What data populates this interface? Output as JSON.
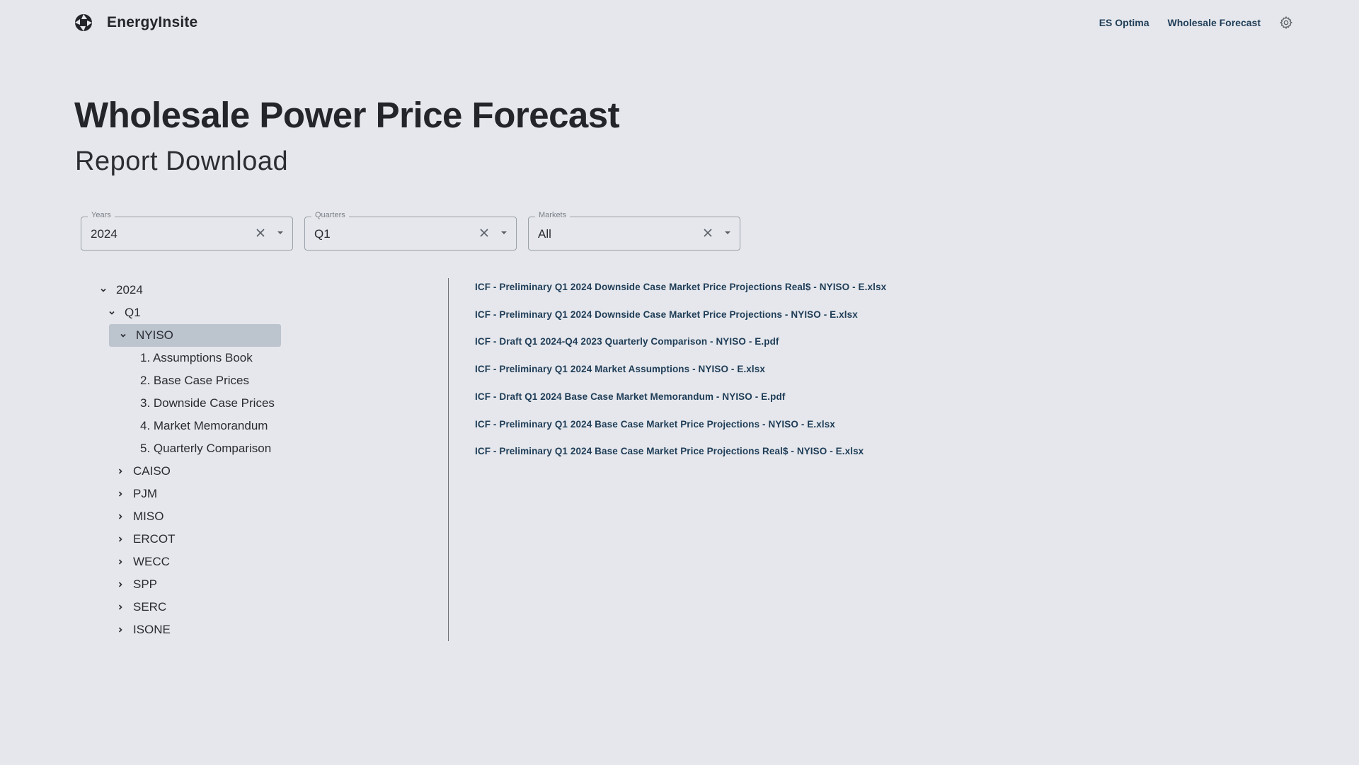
{
  "header": {
    "brand": "EnergyInsite",
    "nav": [
      "ES Optima",
      "Wholesale Forecast"
    ],
    "settings_icon": "gear-icon"
  },
  "page": {
    "title": "Wholesale Power Price Forecast",
    "subtitle": "Report Download"
  },
  "filters": {
    "years": {
      "label": "Years",
      "value": "2024"
    },
    "quarters": {
      "label": "Quarters",
      "value": "Q1"
    },
    "markets": {
      "label": "Markets",
      "value": "All"
    }
  },
  "tree": {
    "year": "2024",
    "quarter": "Q1",
    "selected_market": "NYISO",
    "reports": [
      "1. Assumptions Book",
      "2. Base Case Prices",
      "3. Downside Case Prices",
      "4. Market Memorandum",
      "5. Quarterly Comparison"
    ],
    "other_markets": [
      "CAISO",
      "PJM",
      "MISO",
      "ERCOT",
      "WECC",
      "SPP",
      "SERC",
      "ISONE"
    ]
  },
  "files": [
    "ICF - Preliminary Q1 2024 Downside Case Market Price Projections Real$ - NYISO - E.xlsx",
    "ICF - Preliminary Q1 2024 Downside Case Market Price Projections - NYISO - E.xlsx",
    "ICF - Draft Q1 2024-Q4 2023 Quarterly Comparison - NYISO - E.pdf",
    "ICF - Preliminary Q1 2024 Market Assumptions - NYISO - E.xlsx",
    "ICF - Draft Q1 2024 Base Case Market Memorandum - NYISO - E.pdf",
    "ICF - Preliminary Q1 2024 Base Case Market Price Projections - NYISO - E.xlsx",
    "ICF - Preliminary Q1 2024 Base Case Market Price Projections Real$ - NYISO - E.xlsx"
  ],
  "colors": {
    "background": "#e5e7ec",
    "link": "#1f3d57",
    "selected_node": "#bcc4ce"
  }
}
